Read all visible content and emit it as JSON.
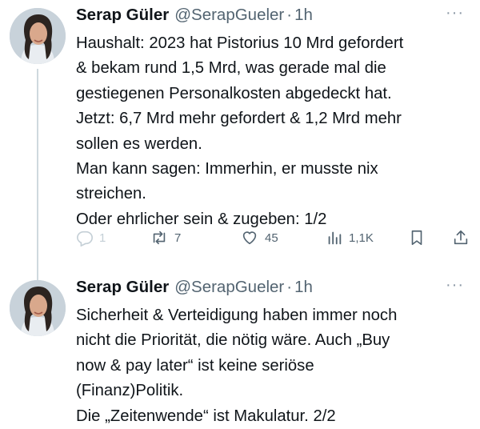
{
  "tweets": [
    {
      "author_name": "Serap Güler",
      "handle": "@SerapGueler",
      "separator": "·",
      "time": "1h",
      "more": "···",
      "lines": [
        "Haushalt: 2023 hat Pistorius 10 Mrd gefordert",
        "& bekam rund 1,5 Mrd, was gerade mal die",
        "gestiegenen Personalkosten abgedeckt hat.",
        "Jetzt: 6,7 Mrd mehr gefordert & 1,2 Mrd mehr",
        "sollen es werden.",
        "Man kann sagen: Immerhin, er musste nix",
        "streichen.",
        "Oder ehrlicher sein & zugeben: 1/2"
      ],
      "actions": {
        "replies": "1",
        "retweets": "7",
        "likes": "45",
        "views": "1,1K"
      },
      "icons": [
        "reply-icon",
        "retweet-icon",
        "like-icon",
        "views-icon",
        "bookmark-icon",
        "share-icon"
      ]
    },
    {
      "author_name": "Serap Güler",
      "handle": "@SerapGueler",
      "separator": "·",
      "time": "1h",
      "more": "···",
      "lines": [
        "Sicherheit & Verteidigung haben immer noch",
        "nicht die Priorität, die nötig wäre. Auch „Buy",
        "now & pay later“ ist keine seriöse",
        "(Finanz)Politik.",
        "Die „Zeitenwende“ ist Makulatur. 2/2"
      ]
    }
  ],
  "colors": {
    "text": "#0f1419",
    "secondary": "#536471",
    "thread_line": "#cfd9de"
  }
}
